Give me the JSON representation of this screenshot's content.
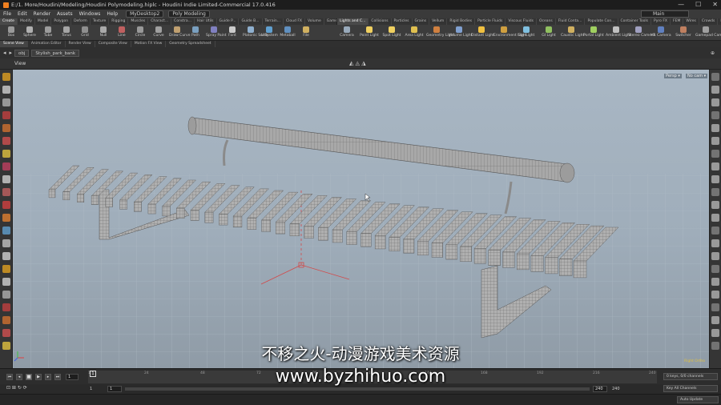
{
  "window": {
    "title": "E:/1. More/Houdini/Modeling/Houdini Polymodeling.hiplc - Houdini Indie Limited-Commercial 17.0.416",
    "minimize": "—",
    "maximize": "☐",
    "close": "✕"
  },
  "menu": [
    "File",
    "Edit",
    "Render",
    "Assets",
    "Windows",
    "Help"
  ],
  "desktop": "MyDesktop2",
  "shelf_set": "Poly Modeling",
  "main_label": "Main",
  "shelf_tabs_left": [
    "Create",
    "Modify",
    "Model",
    "Polygon",
    "Deform",
    "Texture",
    "Rigging",
    "Muscles",
    "Charact...",
    "Constra...",
    "Hair Utils",
    "Guide P...",
    "Guide B...",
    "Terrain...",
    "Cloud FX",
    "Volume",
    "Game De..."
  ],
  "shelf_tabs_right": [
    "Lights and C...",
    "Collisions",
    "Particles",
    "Grains",
    "Vellum",
    "Rigid Bodies",
    "Particle Fluids",
    "Viscous Fluids",
    "Oceans",
    "Fluid Conta...",
    "Populate Con...",
    "Container Tools",
    "Pyro FX",
    "FEM",
    "Wires",
    "Crowds",
    "Drive Simula..."
  ],
  "tools_left": [
    "Box",
    "Sphere",
    "Tube",
    "Torus",
    "Grid",
    "Null",
    "Line",
    "Circle",
    "Curve",
    "Draw Curve",
    "Path",
    "Spray Paint",
    "Font",
    "Platonic Solids",
    "L-System",
    "Metaball",
    "File"
  ],
  "tools_right": [
    "Camera",
    "Point Light",
    "Spot Light",
    "Area Light",
    "Geometry Light",
    "Volume Light",
    "Distant Light",
    "Environment Light",
    "Sky Light",
    "GI Light",
    "Caustic Light",
    "Portal Light",
    "Ambient Light",
    "Stereo Camera",
    "VR Camera",
    "Switcher",
    "Gamepad Camera"
  ],
  "pane_tabs": [
    "Scene View",
    "Animation Editor",
    "Render View",
    "Composite View",
    "Motion FX View",
    "Geometry Spreadsheet"
  ],
  "path": {
    "obj": "obj",
    "node": "Stylish_park_bank"
  },
  "view_label": "View",
  "camera_menu": "Persp ▾",
  "cam_menu": "No cam ▾",
  "ortho_label": "Right Ortho",
  "timeline": {
    "current_frame": "1",
    "ticks": [
      "1",
      "24",
      "48",
      "72",
      "96",
      "120",
      "144",
      "168",
      "192",
      "216",
      "240"
    ],
    "keys_info": "0 keys, 0/0 channels",
    "key_all": "Key All Channels",
    "start": "1",
    "start2": "1",
    "end": "240",
    "end2": "240"
  },
  "status": {
    "auto_update": "Auto Update"
  },
  "watermark": {
    "line1": "不移之火-动漫游戏美术资源",
    "line2": "www.byzhihuo.com"
  },
  "colors": {
    "wire": "#6f6f6f",
    "bench": "#a9a9a9",
    "accent": "#f0a020"
  }
}
